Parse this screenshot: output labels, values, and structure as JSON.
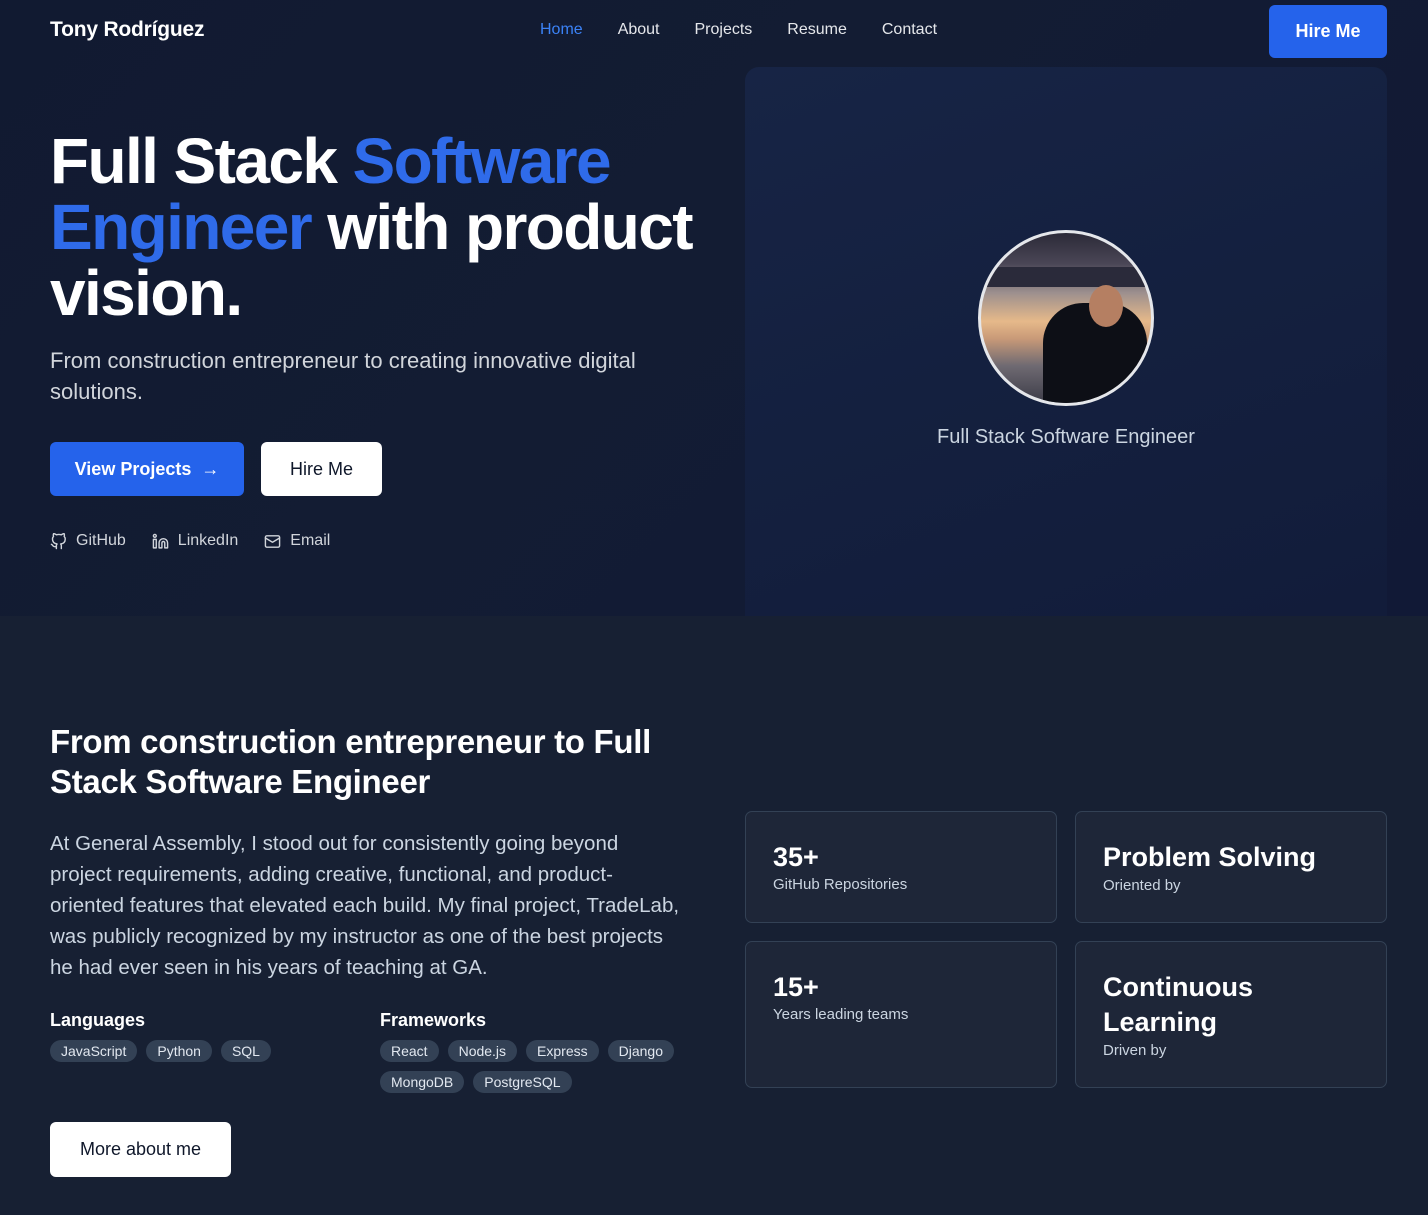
{
  "nav": {
    "brand": "Tony Rodríguez",
    "links": [
      {
        "label": "Home",
        "active": true
      },
      {
        "label": "About",
        "active": false
      },
      {
        "label": "Projects",
        "active": false
      },
      {
        "label": "Resume",
        "active": false
      },
      {
        "label": "Contact",
        "active": false
      }
    ],
    "hire_label": "Hire Me"
  },
  "hero": {
    "headline_part1": "Full Stack ",
    "headline_accent": "Software Engineer",
    "headline_part2": " with product vision.",
    "subtitle": "From construction entrepreneur to creating innovative digital solutions.",
    "primary_button": "View Projects",
    "secondary_button": "Hire Me",
    "socials": [
      {
        "label": "GitHub",
        "icon": "github-icon"
      },
      {
        "label": "LinkedIn",
        "icon": "linkedin-icon"
      },
      {
        "label": "Email",
        "icon": "mail-icon"
      }
    ],
    "profile_role": "Full Stack Software Engineer"
  },
  "about": {
    "title": "From construction entrepreneur to Full Stack Software Engineer",
    "body": "At General Assembly, I stood out for consistently going beyond project requirements, adding creative, functional, and product-oriented features that elevated each build. My final project, TradeLab, was publicly recognized by my instructor as one of the best projects he had ever seen in his years of teaching at GA.",
    "languages_title": "Languages",
    "languages": [
      "JavaScript",
      "Python",
      "SQL"
    ],
    "frameworks_title": "Frameworks",
    "frameworks": [
      "React",
      "Node.js",
      "Express",
      "Django",
      "MongoDB",
      "PostgreSQL"
    ],
    "more_button": "More about me",
    "stats": [
      {
        "value": "35+",
        "label": "GitHub Repositories"
      },
      {
        "value": "Problem Solving",
        "label": "Oriented by"
      },
      {
        "value": "15+",
        "label": "Years leading teams"
      },
      {
        "value": "Continuous Learning",
        "label": "Driven by"
      }
    ]
  },
  "colors": {
    "accent": "#2563eb",
    "background": "#172033",
    "hero_background": "#131c33"
  }
}
